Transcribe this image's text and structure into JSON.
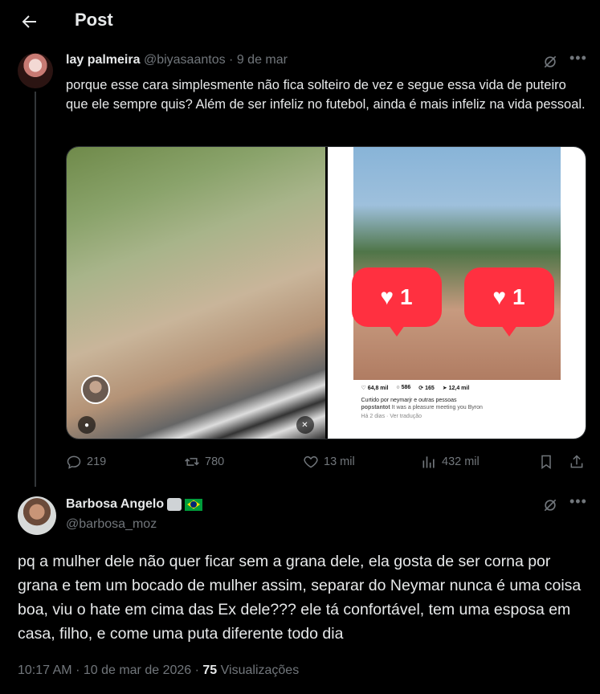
{
  "header": {
    "title": "Post",
    "back_icon": "arrow-left-icon"
  },
  "parent": {
    "name": "lay palmeira",
    "handle": "@biyasaantos",
    "separator": "·",
    "date": "9 de mar",
    "text": "porque esse cara simplesmente não fica solteiro de vez e segue essa vida de puteiro que ele sempre quis? Além de ser infeliz no futebol, ainda é mais infeliz na vida pessoal.",
    "media": {
      "right_post": {
        "likes_badge_1": "1",
        "likes_badge_2": "1",
        "stat_likes": "64,8 mil",
        "stat_comments": "586",
        "stat_reposts": "165",
        "stat_shares": "12,4 mil",
        "liked_by": "Curtido por neymarjr e outras pessoas",
        "caption_user": "popstantot",
        "caption": "It was a pleasure meeting you Byron",
        "time": "Há 2 dias",
        "translate": "Ver tradução"
      }
    },
    "actions": {
      "replies": "219",
      "reposts": "780",
      "likes": "13 mil",
      "views": "432 mil"
    }
  },
  "main": {
    "name": "Barbosa Angelo",
    "handle": "@barbosa_moz",
    "text": "pq a mulher dele não quer ficar sem a grana dele, ela gosta de ser corna por grana e tem um bocado de mulher assim, separar do Neymar nunca é uma coisa boa, viu o hate em cima das Ex dele??? ele tá confortável, tem uma esposa em casa, filho, e come uma puta diferente todo dia",
    "time": "10:17 AM",
    "separator": "·",
    "date": "10 de mar de 2026",
    "views_count": "75",
    "views_label": "Visualizações"
  },
  "colors": {
    "background": "#000000",
    "text": "#e7e9ea",
    "muted": "#71767b",
    "badge_red": "#ff3040"
  }
}
